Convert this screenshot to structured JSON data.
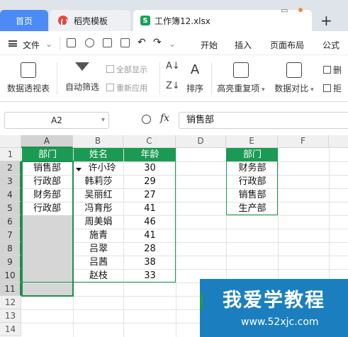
{
  "tabs": [
    {
      "label": "首页"
    },
    {
      "label": "稻壳模板"
    },
    {
      "label": "工作簿12.xlsx",
      "icon_letter": "S"
    }
  ],
  "menu": {
    "file_label": "文件",
    "items": [
      "开始",
      "插入",
      "页面布局",
      "公式"
    ]
  },
  "ribbon": {
    "pivot": "数据透视表",
    "autofilter": "自动筛选",
    "show_all": "全部显示",
    "reapply": "重新应用",
    "sort": "排序",
    "highlight_dup": "高亮重复项",
    "compare": "数据对比",
    "delete_partial": "删",
    "reject_partial": "拒"
  },
  "formula_bar": {
    "name_box": "A2",
    "fx": "fx",
    "content": "销售部"
  },
  "columns": [
    "A",
    "B",
    "C",
    "D",
    "E",
    "F"
  ],
  "rows": [
    "1",
    "2",
    "3",
    "4",
    "5",
    "6",
    "7",
    "8",
    "9",
    "10",
    "11",
    "12",
    "13",
    "14"
  ],
  "table": {
    "headers": [
      "部门",
      "姓名",
      "年龄"
    ],
    "dept": [
      "销售部",
      "行政部",
      "财务部",
      "行政部"
    ],
    "names": [
      "许小玲",
      "韩莉莎",
      "吴丽红",
      "冯育彤",
      "周美娟",
      "施青",
      "吕翠",
      "吕茜",
      "赵枝"
    ],
    "ages": [
      "30",
      "29",
      "27",
      "41",
      "46",
      "41",
      "28",
      "38",
      "33"
    ]
  },
  "lookup": {
    "header": "部门",
    "values": [
      "财务部",
      "行政部",
      "销售部",
      "生产部"
    ]
  },
  "watermark": {
    "title": "我爱学教程",
    "url": "www.52xjc.com"
  },
  "colors": {
    "header_green": "#1b9a53",
    "tab_blue": "#4b8bf5",
    "watermark_blue": "#1b7fbf"
  }
}
